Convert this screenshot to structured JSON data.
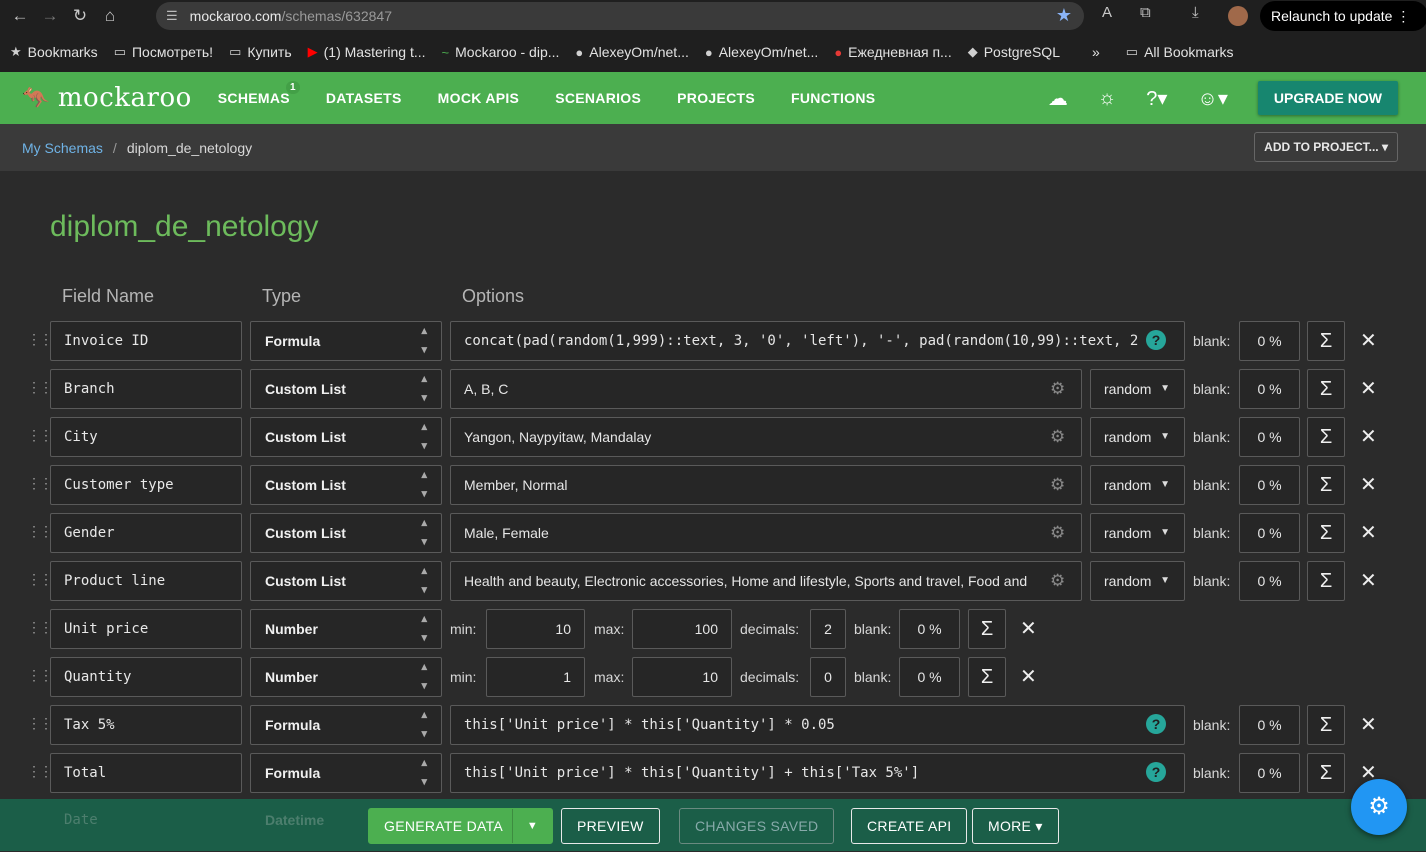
{
  "browser": {
    "url_host": "mockaroo.com",
    "url_path": "/schemas/632847",
    "relaunch_label": "Relaunch to update"
  },
  "bookmarks": [
    {
      "label": "Bookmarks",
      "icon": "star-icon"
    },
    {
      "label": "Посмотреть!",
      "icon": "folder-icon"
    },
    {
      "label": "Купить",
      "icon": "folder-icon"
    },
    {
      "label": "(1) Mastering t...",
      "icon": "youtube-icon"
    },
    {
      "label": "Mockaroo - dip...",
      "icon": "mockaroo-icon"
    },
    {
      "label": "AlexeyOm/net...",
      "icon": "github-icon"
    },
    {
      "label": "AlexeyOm/net...",
      "icon": "github-icon"
    },
    {
      "label": "Ежедневная п...",
      "icon": "site-icon"
    },
    {
      "label": "PostgreSQL",
      "icon": "site-icon"
    },
    {
      "label": "»",
      "icon": ""
    },
    {
      "label": "All Bookmarks",
      "icon": "folder-icon"
    }
  ],
  "appbar": {
    "logo": "mockaroo",
    "nav": [
      {
        "label": "SCHEMAS",
        "badge": "1"
      },
      {
        "label": "DATASETS",
        "badge": ""
      },
      {
        "label": "MOCK APIS",
        "badge": ""
      },
      {
        "label": "SCENARIOS",
        "badge": ""
      },
      {
        "label": "PROJECTS",
        "badge": ""
      },
      {
        "label": "FUNCTIONS",
        "badge": ""
      }
    ],
    "upgrade_label": "UPGRADE NOW"
  },
  "breadcrumb": {
    "parent": "My Schemas",
    "separator": "/",
    "current": "diplom_de_netology",
    "add_to_project": "ADD TO PROJECT..."
  },
  "schema_title": "diplom_de_netology",
  "columns": {
    "field": "Field Name",
    "type": "Type",
    "options": "Options"
  },
  "labels": {
    "blank": "blank:",
    "min": "min:",
    "max": "max:",
    "decimals": "decimals:",
    "random": "random"
  },
  "rows": [
    {
      "name": "Invoice ID",
      "type": "Formula",
      "options": "concat(pad(random(1,999)::text, 3, '0', 'left'), '-', pad(random(10,99)::text, 2",
      "blank": "0 %"
    },
    {
      "name": "Branch",
      "type": "Custom List",
      "options": "A, B, C",
      "blank": "0 %"
    },
    {
      "name": "City",
      "type": "Custom List",
      "options": "Yangon, Naypyitaw, Mandalay",
      "blank": "0 %"
    },
    {
      "name": "Customer type",
      "type": "Custom List",
      "options": "Member, Normal",
      "blank": "0 %"
    },
    {
      "name": "Gender",
      "type": "Custom List",
      "options": "Male, Female",
      "blank": "0 %"
    },
    {
      "name": "Product line",
      "type": "Custom List",
      "options": "Health and beauty, Electronic accessories, Home and lifestyle, Sports and travel, Food and",
      "blank": "0 %"
    },
    {
      "name": "Unit price",
      "type": "Number",
      "min": "10",
      "max": "100",
      "decimals": "2",
      "blank": "0 %"
    },
    {
      "name": "Quantity",
      "type": "Number",
      "min": "1",
      "max": "10",
      "decimals": "0",
      "blank": "0 %"
    },
    {
      "name": "Tax 5%",
      "type": "Formula",
      "options": "this['Unit price'] * this['Quantity'] * 0.05",
      "blank": "0 %"
    },
    {
      "name": "Total",
      "type": "Formula",
      "options": "this['Unit price'] * this['Quantity'] + this['Tax 5%']",
      "blank": "0 %"
    },
    {
      "name": "Date",
      "type": "Datetime"
    }
  ],
  "footer": {
    "generate": "GENERATE DATA",
    "preview": "PREVIEW",
    "changes_saved": "CHANGES SAVED",
    "create_api": "CREATE API",
    "more": "MORE"
  }
}
